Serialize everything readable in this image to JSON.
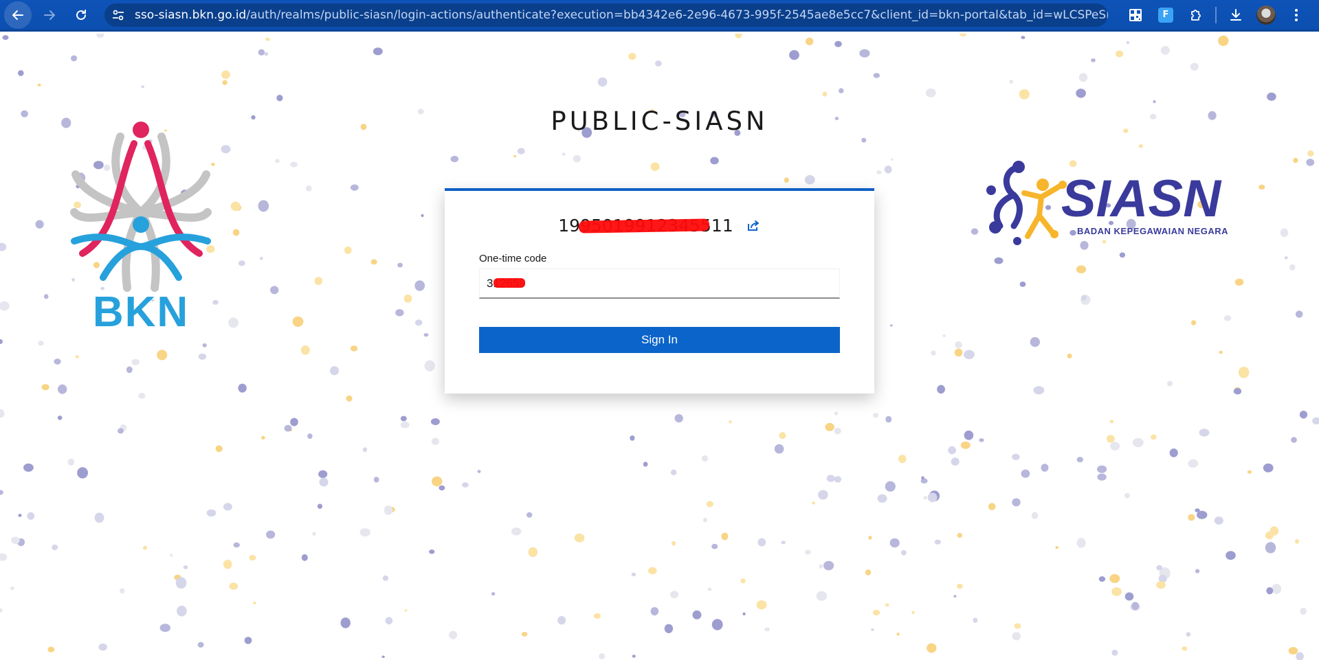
{
  "browser": {
    "url_host": "sso-siasn.bkn.go.id",
    "url_path": "/auth/realms/public-siasn/login-actions/authenticate?execution=bb4342e6-2e96-4673-995f-2545ae8e5cc7&client_id=bkn-portal&tab_id=wLCSPeSETpg",
    "extension_f_label": "F",
    "icons": {
      "back": "arrow-left-icon",
      "forward": "arrow-right-icon",
      "reload": "reload-icon",
      "site_info": "tune-icon",
      "translate": "translate-icon",
      "bookmark": "star-icon",
      "qr": "qr-code-icon",
      "extensions": "puzzle-icon",
      "downloads": "download-icon",
      "menu": "kebab-menu-icon"
    }
  },
  "page": {
    "realm_title": "PUBLIC-SIASN",
    "logo_left": {
      "text": "BKN"
    },
    "logo_right": {
      "text": "SIASN",
      "subtitle": "BADAN KEPEGAWAIAN NEGARA"
    }
  },
  "login": {
    "username_display": "1995019912345511",
    "otp_label": "One-time code",
    "otp_value": "312659",
    "signin_label": "Sign In"
  },
  "colors": {
    "toolbar": "#0e53b8",
    "card_accent": "#0f5fc4",
    "primary_button": "#0b64c9",
    "redaction": "#ff0a0a",
    "bkn_pink": "#e0245e",
    "bkn_blue": "#27a1dc",
    "siasn_navy": "#3a3a9c",
    "siasn_yellow": "#f7b52c"
  }
}
